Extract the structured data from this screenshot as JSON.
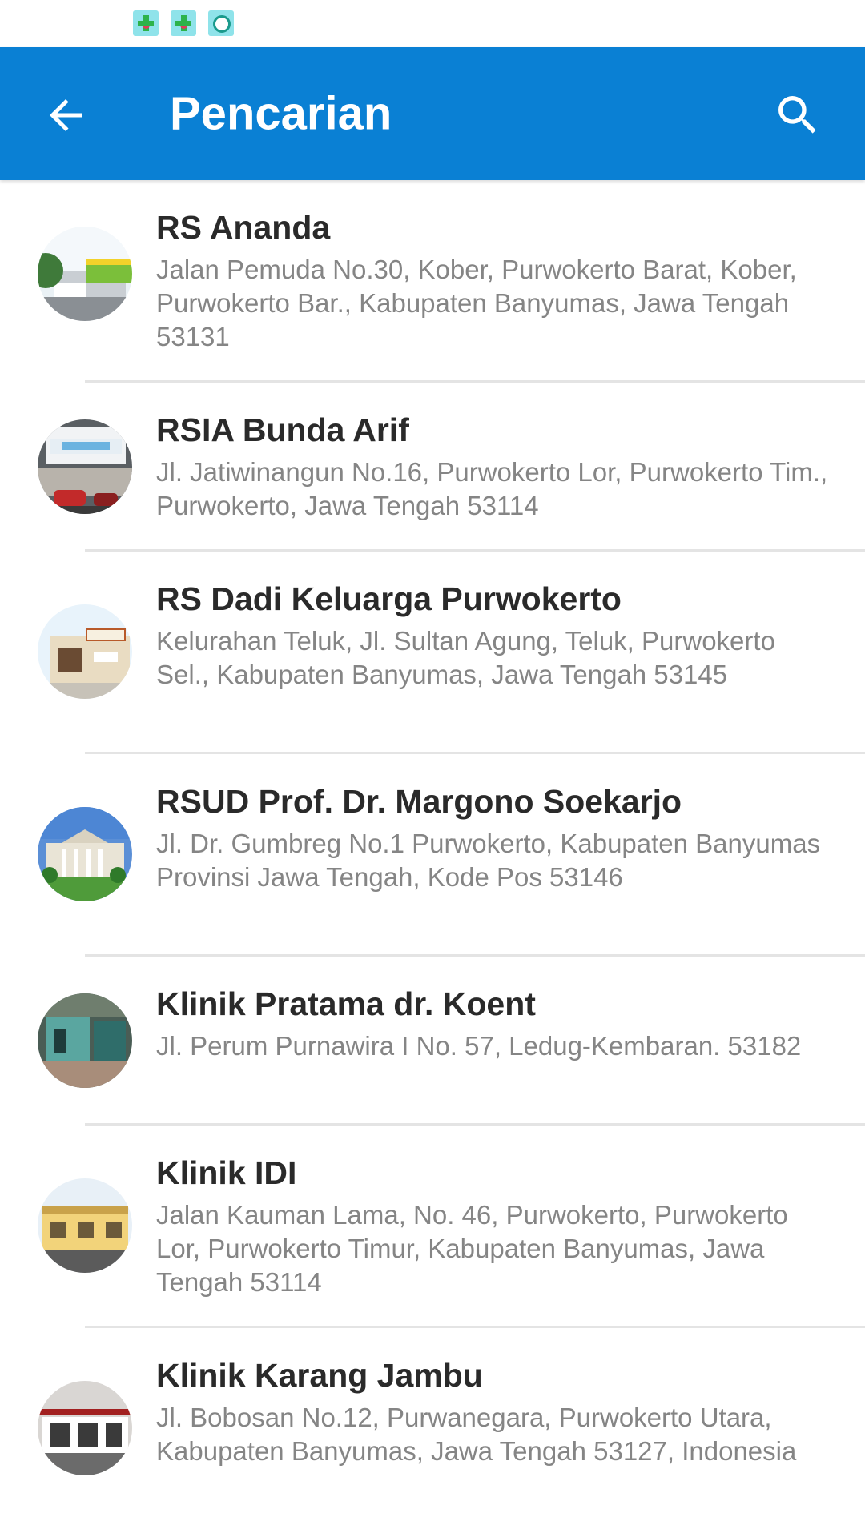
{
  "status_bar": {
    "icons": [
      "notification-app-icon",
      "notification-app-icon",
      "notification-app-icon"
    ]
  },
  "toolbar": {
    "title": "Pencarian",
    "back_icon": "arrow-left-icon",
    "search_icon": "search-icon",
    "color": "#0a80d4"
  },
  "items": [
    {
      "name": "RS Ananda",
      "address": "Jalan Pemuda No.30, Kober, Purwokerto Barat, Kober, Purwokerto Bar., Kabupaten Banyumas, Jawa Tengah 53131"
    },
    {
      "name": "RSIA Bunda Arif",
      "address": "Jl. Jatiwinangun No.16, Purwokerto Lor, Purwokerto Tim., Purwokerto, Jawa Tengah 53114"
    },
    {
      "name": "RS Dadi Keluarga Purwokerto",
      "address": "Kelurahan Teluk, Jl. Sultan Agung, Teluk, Purwokerto Sel., Kabupaten Banyumas, Jawa Tengah 53145"
    },
    {
      "name": "RSUD Prof. Dr. Margono Soekarjo",
      "address": "Jl. Dr. Gumbreg No.1 Purwokerto, Kabupaten Banyumas Provinsi Jawa Tengah, Kode Pos 53146"
    },
    {
      "name": "Klinik Pratama dr. Koent",
      "address": "Jl. Perum Purnawira I No. 57, Ledug-Kembaran. 53182"
    },
    {
      "name": " Klinik IDI",
      "address": "Jalan Kauman Lama, No. 46, Purwokerto, Purwokerto Lor, Purwokerto Timur, Kabupaten Banyumas, Jawa Tengah 53114"
    },
    {
      "name": "Klinik Karang Jambu",
      "address": "Jl. Bobosan No.12, Purwanegara, Purwokerto Utara, Kabupaten Banyumas, Jawa Tengah 53127, Indonesia"
    }
  ]
}
